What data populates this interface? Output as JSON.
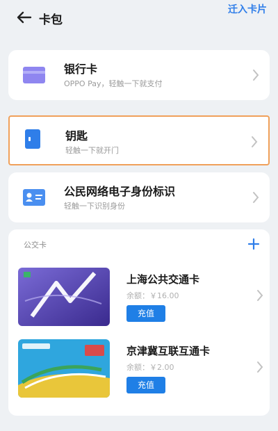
{
  "header": {
    "title": "卡包",
    "migrate_label": "迁入卡片"
  },
  "cards": [
    {
      "title": "银行卡",
      "subtitle": "OPPO Pay，轻触一下就支付",
      "icon": "bank-card-icon"
    },
    {
      "title": "钥匙",
      "subtitle": "轻触一下就开门",
      "icon": "key-card-icon"
    },
    {
      "title": "公民网络电子身份标识",
      "subtitle": "轻触一下识别身份",
      "icon": "id-card-icon"
    }
  ],
  "transit": {
    "label": "公交卡",
    "cards": [
      {
        "name": "上海公共交通卡",
        "balance": "余额：￥16.00",
        "button": "充值"
      },
      {
        "name": "京津冀互联互通卡",
        "balance": "余额：￥2.00",
        "button": "充值"
      }
    ]
  },
  "colors": {
    "accent": "#2f7ee9",
    "button": "#1f7fe6",
    "selected_border": "#f0a05a"
  }
}
